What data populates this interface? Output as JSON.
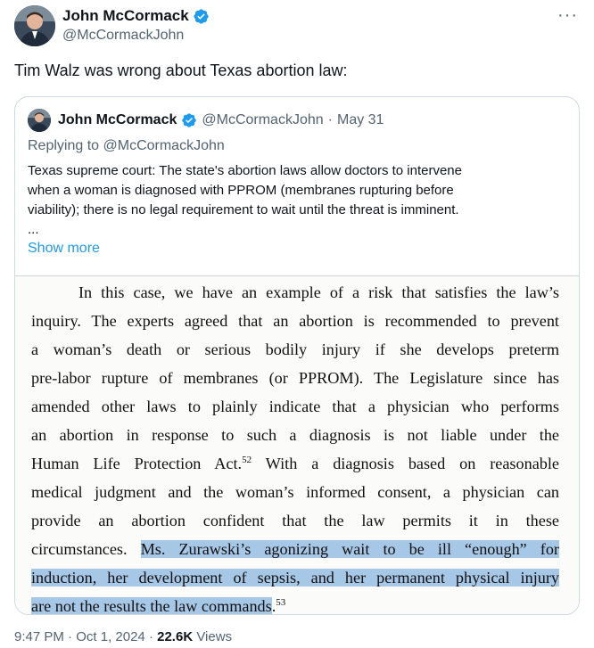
{
  "author": {
    "name": "John McCormack",
    "handle": "@McCormackJohn"
  },
  "tweet": {
    "text": "Tim Walz was wrong about Texas abortion law:"
  },
  "quoted": {
    "name": "John McCormack",
    "handle": "@McCormackJohn",
    "separator": "·",
    "date": "May 31",
    "reply_to": "Replying to @McCormackJohn",
    "text_lines": [
      "Texas supreme court: The state's abortion laws allow doctors to intervene",
      "when a woman is diagnosed with PPROM (membranes rupturing before",
      "viability); there is no legal requirement to wait until the threat is imminent.",
      "..."
    ],
    "show_more": "Show more"
  },
  "document": {
    "lines": {
      "l1": "In this case, we have an example of a risk that satisfies the law’s",
      "l2": "inquiry. The experts agreed that an abortion is recommended to prevent",
      "l3": "a woman’s death or serious bodily injury if she develops preterm",
      "l4": "pre-labor rupture of membranes (or PPROM). The Legislature since has",
      "l5": "amended other laws to plainly indicate that a physician who performs",
      "l6": "an abortion in response to such a diagnosis is not liable under the",
      "l7a": "Human Life Protection Act.",
      "l7sup": "52",
      "l7b": " With a diagnosis based on reasonable",
      "l8": "medical judgment and the woman’s informed consent, a physician can",
      "l9": "provide an abortion confident that the law permits it in these",
      "l10a": "circumstances. ",
      "l10b": "Ms. Zurawski’s agonizing wait to be ill “enough” for",
      "l11": "induction, her development of sepsis, and her permanent physical injury",
      "l12a": "are not the results the law commands",
      "l12b": ".",
      "l12sup": "53"
    }
  },
  "footer": {
    "time": "9:47 PM",
    "separator": "·",
    "date": "Oct 1, 2024",
    "views_count": "22.6K",
    "views_label": "Views"
  },
  "icons": {
    "verified": "verified-badge-icon",
    "more": "more-options-icon"
  },
  "colors": {
    "verified": "#1d9bf0",
    "link": "#1d9bf0",
    "highlight": "#a7c7e7"
  }
}
